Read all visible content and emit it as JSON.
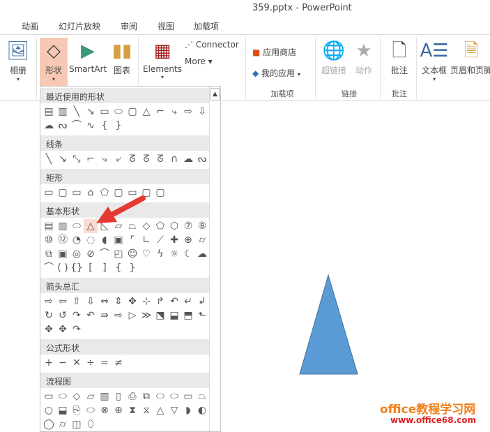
{
  "window_title": "359.pptx - PowerPoint",
  "tabs": [
    "动画",
    "幻灯片放映",
    "审阅",
    "视图",
    "加载项"
  ],
  "ribbon": {
    "album": "相册",
    "shapes": "形状",
    "smartart": "SmartArt",
    "chart": "图表",
    "elements": "Elements",
    "connector": "Connector",
    "more": "More ▾",
    "store": "应用商店",
    "myapps": "我的应用",
    "hyperlink": "超链接",
    "action": "动作",
    "comment": "批注",
    "textbox": "文本框",
    "header_footer": "页眉和页脚",
    "groups": {
      "addins": "加载项",
      "links": "链接",
      "comments": "批注"
    }
  },
  "gallery": [
    {
      "title": "最近使用的形状",
      "rows": [
        [
          "▤",
          "▥",
          "╲",
          "↘",
          "▭",
          "⬭",
          "▢",
          "△",
          "⌐",
          "⤷",
          "⇨",
          "⇩"
        ],
        [
          "☁",
          "ᔓ",
          "⌒",
          "∿",
          "{",
          "}"
        ]
      ]
    },
    {
      "title": "线条",
      "rows": [
        [
          "╲",
          "↘",
          "⤡",
          "⌐",
          "⤷",
          "⤶",
          "ᘔ",
          "ᘔ",
          "ᘔ",
          "∩",
          "☁",
          "ᔓ"
        ]
      ]
    },
    {
      "title": "矩形",
      "rows": [
        [
          "▭",
          "▢",
          "▭",
          "⌂",
          "⬠",
          "▢",
          "▭",
          "▢",
          "▢"
        ]
      ]
    },
    {
      "title": "基本形状",
      "rows": [
        [
          "▤",
          "▥",
          "⬭",
          "△",
          "◺",
          "▱",
          "⏢",
          "◇",
          "⬠",
          "⬡",
          "⑦",
          "⑧"
        ],
        [
          "⑩",
          "⑫",
          "◔",
          "◌",
          "◖",
          "▣",
          "⌜",
          "∟",
          "⟋",
          "✚",
          "⊕",
          "⌭"
        ],
        [
          "⧉",
          "▣",
          "◎",
          "⊘",
          "⌒",
          "◰",
          "☺",
          "♡",
          "ϟ",
          "☼",
          "☾",
          "☁"
        ],
        [
          "⌒",
          "( )",
          "{}",
          "[",
          "]",
          "{",
          "}"
        ]
      ]
    },
    {
      "title": "箭头总汇",
      "rows": [
        [
          "⇨",
          "⇦",
          "⇧",
          "⇩",
          "⇔",
          "⇕",
          "✥",
          "⊹",
          "↱",
          "↶",
          "↵",
          "↲"
        ],
        [
          "↻",
          "↺",
          "↷",
          "↶",
          "⇛",
          "⇨",
          "▷",
          "≫",
          "⬔",
          "⬓",
          "⬒",
          "⬑"
        ],
        [
          "✥",
          "✥",
          "↷"
        ]
      ]
    },
    {
      "title": "公式形状",
      "rows": [
        [
          "+",
          "−",
          "✕",
          "÷",
          "=",
          "≠"
        ]
      ]
    },
    {
      "title": "流程图",
      "rows": [
        [
          "▭",
          "⬭",
          "◇",
          "▱",
          "▥",
          "▯",
          "⎙",
          "⧉",
          "⬭",
          "⬭",
          "▭",
          "⏢"
        ],
        [
          "○",
          "⬓",
          "⎘",
          "⬭",
          "⊗",
          "⊕",
          "⧗",
          "⧖",
          "△",
          "▽",
          "◗",
          "◐"
        ],
        [
          "◯",
          "⌭",
          "◫",
          "⬯"
        ]
      ]
    },
    {
      "title": "星与旗帜",
      "rows": []
    }
  ],
  "highlighted_shape": "三角形",
  "slide_shape_color": "#5b9bd5",
  "watermark": {
    "line1": "office教程学习网",
    "line2": "www.office68.com"
  }
}
